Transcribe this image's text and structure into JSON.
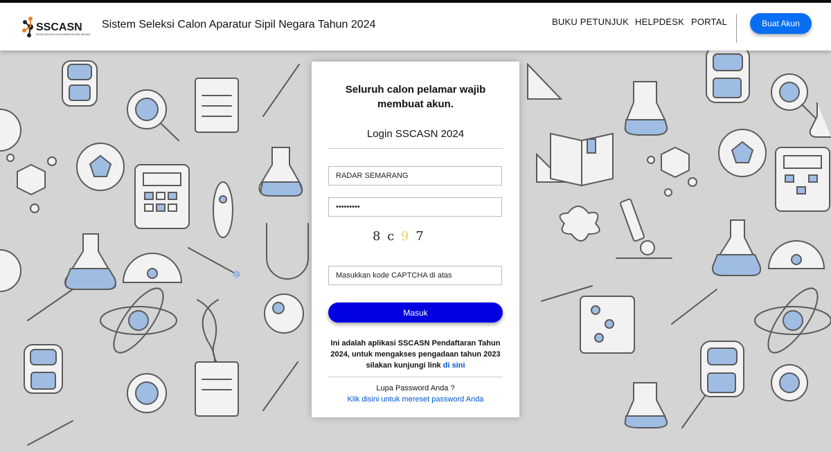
{
  "header": {
    "site_title": "Sistem Seleksi Calon Aparatur Sipil Negara Tahun 2024",
    "logo_text": "SSCASN",
    "logo_subtext": "SISTEM SELEKSI CALON APARATUR SIPIL NEGARA",
    "nav": [
      "BUKU PETUNJUK",
      "HELPDESK",
      "PORTAL"
    ],
    "create_account_label": "Buat Akun"
  },
  "login": {
    "heading": "Seluruh calon pelamar wajib membuat akun.",
    "title": "Login SSCASN 2024",
    "username_value": "RADAR SEMARANG",
    "password_value": "•••••••••",
    "captcha_chars": [
      "8",
      "c",
      "9",
      "7"
    ],
    "captcha_placeholder": "Masukkan kode CAPTCHA di atas",
    "submit_label": "Masuk",
    "info_text": "Ini adalah aplikasi SSCASN Pendaftaran Tahun 2024, untuk mengakses pengadaan tahun 2023 silakan kunjungi link ",
    "info_link": "di sini",
    "forgot_text": "Lupa Password Anda ?",
    "reset_link": "Klik disini untuk mereset password Anda"
  },
  "colors": {
    "primary_button": "#0000e0",
    "create_account_button": "#0a6ef2",
    "link": "#0055cc",
    "background": "#d4d4d4",
    "doodle_accent": "#9fbde3"
  }
}
